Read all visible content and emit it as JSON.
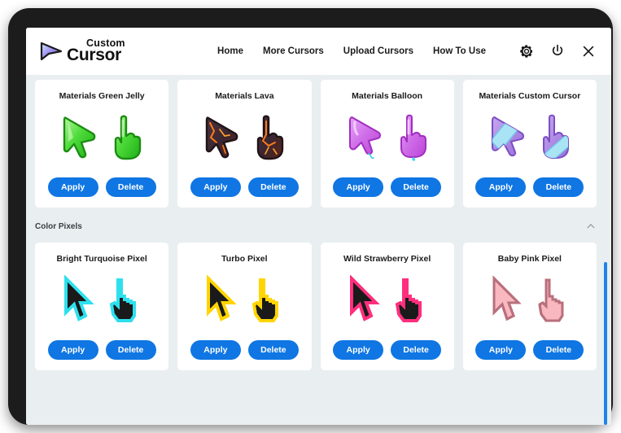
{
  "header": {
    "brand": {
      "top": "Custom",
      "bottom": "Cursor",
      "arrow_icon": "cursor-arrow-logo"
    },
    "nav": [
      {
        "label": "Home",
        "name": "nav-home"
      },
      {
        "label": "More Cursors",
        "name": "nav-more-cursors"
      },
      {
        "label": "Upload Cursors",
        "name": "nav-upload-cursors"
      },
      {
        "label": "How To Use",
        "name": "nav-how-to-use"
      }
    ],
    "icons": [
      {
        "name": "gear-icon"
      },
      {
        "name": "power-icon"
      },
      {
        "name": "close-icon"
      }
    ]
  },
  "buttons": {
    "apply": "Apply",
    "delete": "Delete"
  },
  "colors": {
    "button_blue": "#0f76e3",
    "page_background": "#e9eef1",
    "card_background": "#ffffff",
    "bezel": "#1c1c1c",
    "scrollbar": "#1f83e8"
  },
  "rows": [
    {
      "section": null,
      "cards": [
        {
          "title": "Materials Green Jelly",
          "style": "jelly-green"
        },
        {
          "title": "Materials Lava",
          "style": "lava"
        },
        {
          "title": "Materials Balloon",
          "style": "balloon"
        },
        {
          "title": "Materials Custom Cursor",
          "style": "custom-purple"
        }
      ]
    },
    {
      "section": {
        "title": "Color Pixels",
        "collapse_icon": "chevron-up-icon"
      },
      "cards": [
        {
          "title": "Bright Turquoise Pixel",
          "style": "pixel-turquoise"
        },
        {
          "title": "Turbo Pixel",
          "style": "pixel-yellow"
        },
        {
          "title": "Wild Strawberry Pixel",
          "style": "pixel-pink"
        },
        {
          "title": "Baby Pink Pixel",
          "style": "pixel-babypink"
        }
      ]
    }
  ],
  "scrollbar": {
    "name": "vertical-scrollbar"
  }
}
